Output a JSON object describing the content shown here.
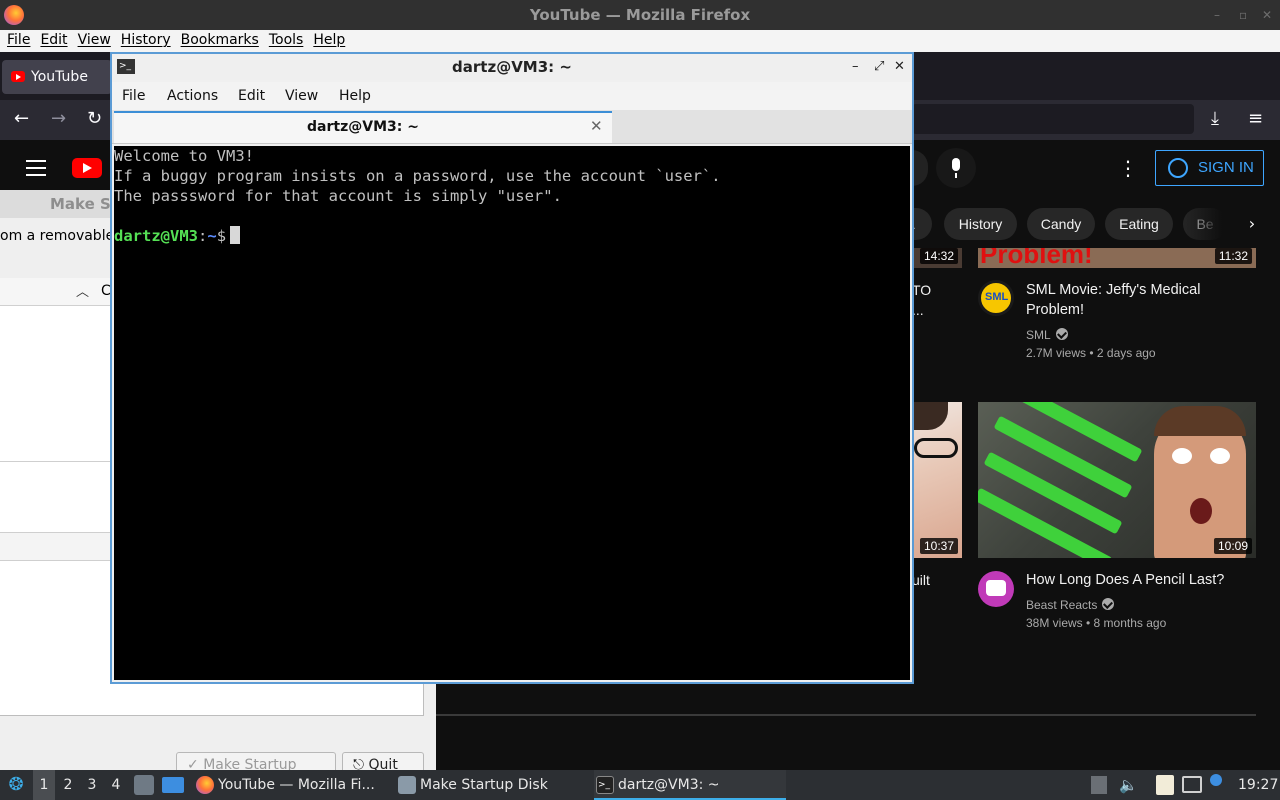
{
  "firefox": {
    "window_title": "YouTube — Mozilla Firefox",
    "menu": [
      "File",
      "Edit",
      "View",
      "History",
      "Bookmarks",
      "Tools",
      "Help"
    ],
    "tab_title": "YouTube",
    "nav_icons": [
      "back-arrow-icon",
      "forward-arrow-icon",
      "reload-icon",
      "star-icon",
      "download-icon",
      "hamburger-menu-icon"
    ]
  },
  "youtube": {
    "sign_in": "SIGN IN",
    "chips": [
      "A",
      "History",
      "Candy",
      "Eating",
      "Be"
    ],
    "videos": [
      {
        "duration": "14:32",
        "title_fragment": "TO",
        "title_fragment2": "..."
      },
      {
        "duration": "11:32",
        "title": "SML Movie: Jeffy's Medical Problem!",
        "channel": "SML",
        "meta": "2.7M views • 2 days ago",
        "verified": true,
        "thumb_text": "Problem!"
      },
      {
        "duration": "10:37",
        "title_fragment": "uilt"
      },
      {
        "duration": "10:09",
        "title": "How Long Does A Pencil Last?",
        "channel": "Beast Reacts",
        "meta": "38M views • 8 months ago",
        "verified": true
      }
    ],
    "accent_color": "#3ea6ff"
  },
  "startup_disk": {
    "title": "Make S",
    "instruction_fragment": "om a removable",
    "column_fragment": "C",
    "buttons": [
      "Make Startup Disk",
      "Quit"
    ]
  },
  "terminal": {
    "window_title": "dartz@VM3: ~",
    "menu": [
      "File",
      "Actions",
      "Edit",
      "View",
      "Help"
    ],
    "tab_title": "dartz@VM3: ~",
    "lines": [
      "Welcome to VM3!",
      "If a buggy program insists on a password, use the account `user`.",
      "The passsword for that account is simply \"user\"."
    ],
    "prompt_user": "dartz@VM3",
    "prompt_sep": ":",
    "prompt_path": "~",
    "prompt_symbol": "$"
  },
  "taskbar": {
    "workspaces": [
      "1",
      "2",
      "3",
      "4"
    ],
    "tasks": [
      {
        "label": "YouTube — Mozilla Fi...",
        "icon": "firefox-icon"
      },
      {
        "label": "Make Startup Disk",
        "icon": "startup-disk-icon"
      },
      {
        "label": "dartz@VM3: ~",
        "icon": "terminal-icon"
      }
    ],
    "time": "19:27"
  }
}
